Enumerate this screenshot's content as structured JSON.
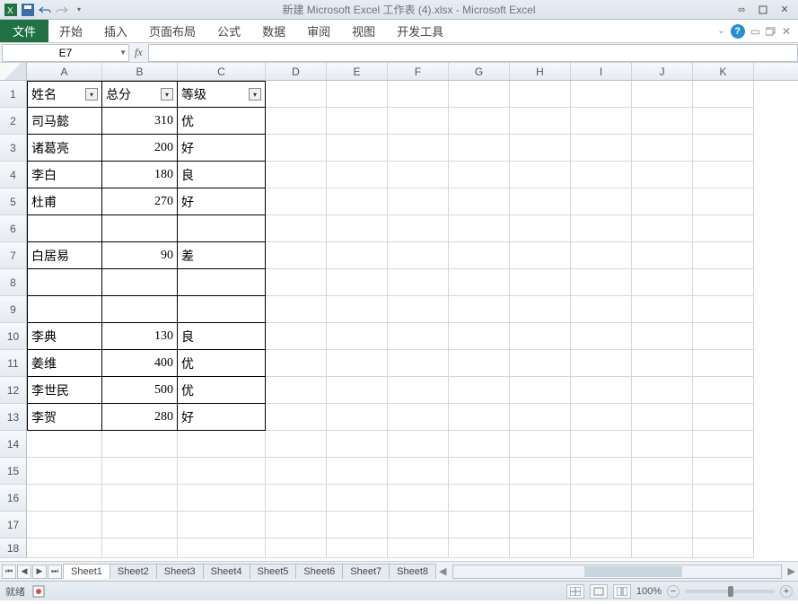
{
  "title": "新建 Microsoft Excel 工作表 (4).xlsx  -  Microsoft Excel",
  "ribbon": {
    "file": "文件",
    "tabs": [
      "开始",
      "插入",
      "页面布局",
      "公式",
      "数据",
      "审阅",
      "视图",
      "开发工具"
    ]
  },
  "name_box": "E7",
  "fx_label": "fx",
  "columns": [
    "A",
    "B",
    "C",
    "D",
    "E",
    "F",
    "G",
    "H",
    "I",
    "J",
    "K"
  ],
  "row_headers": [
    "1",
    "2",
    "3",
    "4",
    "5",
    "6",
    "7",
    "8",
    "9",
    "10",
    "11",
    "12",
    "13",
    "14",
    "15",
    "16",
    "17",
    "18"
  ],
  "table": {
    "headers": {
      "name": "姓名",
      "score": "总分",
      "grade": "等级"
    },
    "rows": [
      {
        "name": "司马懿",
        "score": "310",
        "grade": "优"
      },
      {
        "name": "诸葛亮",
        "score": "200",
        "grade": "好"
      },
      {
        "name": "李白",
        "score": "180",
        "grade": "良"
      },
      {
        "name": "杜甫",
        "score": "270",
        "grade": "好"
      },
      {
        "name": "",
        "score": "",
        "grade": ""
      },
      {
        "name": "白居易",
        "score": "90",
        "grade": "差"
      },
      {
        "name": "",
        "score": "",
        "grade": ""
      },
      {
        "name": "",
        "score": "",
        "grade": ""
      },
      {
        "name": "李典",
        "score": "130",
        "grade": "良"
      },
      {
        "name": "姜维",
        "score": "400",
        "grade": "优"
      },
      {
        "name": "李世民",
        "score": "500",
        "grade": "优"
      },
      {
        "name": "李贺",
        "score": "280",
        "grade": "好"
      }
    ]
  },
  "sheets": [
    "Sheet1",
    "Sheet2",
    "Sheet3",
    "Sheet4",
    "Sheet5",
    "Sheet6",
    "Sheet7",
    "Sheet8"
  ],
  "status": {
    "ready": "就绪",
    "zoom": "100%"
  }
}
